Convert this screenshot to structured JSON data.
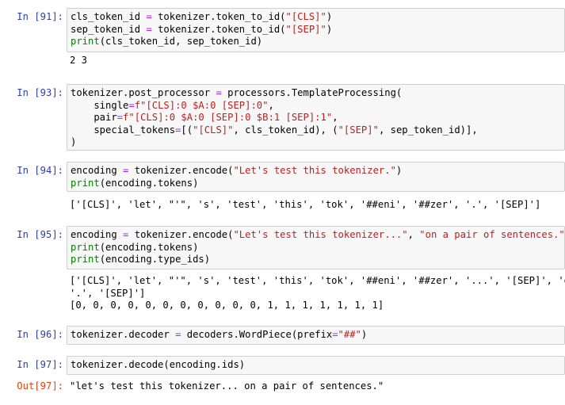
{
  "cells": [
    {
      "prompt": "In [91]:",
      "code": [
        [
          [
            "t",
            "cls_token_id "
          ],
          [
            "o",
            "="
          ],
          [
            "t",
            " tokenizer.token_to_id("
          ],
          [
            "s",
            "\"[CLS]\""
          ],
          [
            "t",
            ")"
          ]
        ],
        [
          [
            "t",
            "sep_token_id "
          ],
          [
            "o",
            "="
          ],
          [
            "t",
            " tokenizer.token_to_id("
          ],
          [
            "s",
            "\"[SEP]\""
          ],
          [
            "t",
            ")"
          ]
        ],
        [
          [
            "k",
            "print"
          ],
          [
            "t",
            "(cls_token_id, sep_token_id)"
          ]
        ]
      ],
      "output": [
        "2 3"
      ]
    },
    {
      "prompt": "In [93]:",
      "code": [
        [
          [
            "t",
            "tokenizer.post_processor "
          ],
          [
            "o",
            "="
          ],
          [
            "t",
            " processors.TemplateProcessing("
          ]
        ],
        [
          [
            "t",
            "    single"
          ],
          [
            "o",
            "="
          ],
          [
            "s",
            "f\"[CLS]:0 $A:0 [SEP]:0\""
          ],
          [
            "t",
            ","
          ]
        ],
        [
          [
            "t",
            "    pair"
          ],
          [
            "o",
            "="
          ],
          [
            "s",
            "f\"[CLS]:0 $A:0 [SEP]:0 $B:1 [SEP]:1\""
          ],
          [
            "t",
            ","
          ]
        ],
        [
          [
            "t",
            "    special_tokens"
          ],
          [
            "o",
            "="
          ],
          [
            "t",
            "[("
          ],
          [
            "s",
            "\"[CLS]\""
          ],
          [
            "t",
            ", cls_token_id), ("
          ],
          [
            "s",
            "\"[SEP]\""
          ],
          [
            "t",
            ", sep_token_id)],"
          ]
        ],
        [
          [
            "t",
            ")"
          ]
        ]
      ],
      "output": []
    },
    {
      "prompt": "In [94]:",
      "code": [
        [
          [
            "t",
            "encoding "
          ],
          [
            "o",
            "="
          ],
          [
            "t",
            " tokenizer.encode("
          ],
          [
            "s",
            "\"Let's test this tokenizer.\""
          ],
          [
            "t",
            ")"
          ]
        ],
        [
          [
            "k",
            "print"
          ],
          [
            "t",
            "(encoding.tokens)"
          ]
        ]
      ],
      "output": [
        "['[CLS]', 'let', \"'\", 's', 'test', 'this', 'tok', '##eni', '##zer', '.', '[SEP]']"
      ]
    },
    {
      "prompt": "In [95]:",
      "code": [
        [
          [
            "t",
            "encoding "
          ],
          [
            "o",
            "="
          ],
          [
            "t",
            " tokenizer.encode("
          ],
          [
            "s",
            "\"Let's test this tokenizer...\""
          ],
          [
            "t",
            ", "
          ],
          [
            "s",
            "\"on a pair of sentences.\""
          ],
          [
            "t",
            ")"
          ]
        ],
        [
          [
            "k",
            "print"
          ],
          [
            "t",
            "(encoding.tokens)"
          ]
        ],
        [
          [
            "k",
            "print"
          ],
          [
            "t",
            "(encoding.type_ids)"
          ]
        ]
      ],
      "output": [
        "['[CLS]', 'let', \"'\", 's', 'test', 'this', 'tok', '##eni', '##zer', '...', '[SEP]', 'on',",
        "'.', '[SEP]']",
        "[0, 0, 0, 0, 0, 0, 0, 0, 0, 0, 0, 1, 1, 1, 1, 1, 1, 1]"
      ]
    },
    {
      "prompt": "In [96]:",
      "code": [
        [
          [
            "t",
            "tokenizer.decoder "
          ],
          [
            "o",
            "="
          ],
          [
            "t",
            " decoders.WordPiece(prefix"
          ],
          [
            "o",
            "="
          ],
          [
            "s",
            "\"##\""
          ],
          [
            "t",
            ")"
          ]
        ]
      ],
      "output": []
    },
    {
      "prompt": "In [97]:",
      "code": [
        [
          [
            "t",
            "tokenizer.decode(encoding.ids)"
          ]
        ]
      ],
      "out_prompt": "Out[97]:",
      "output": [
        "\"let's test this tokenizer... on a pair of sentences.\""
      ]
    }
  ]
}
